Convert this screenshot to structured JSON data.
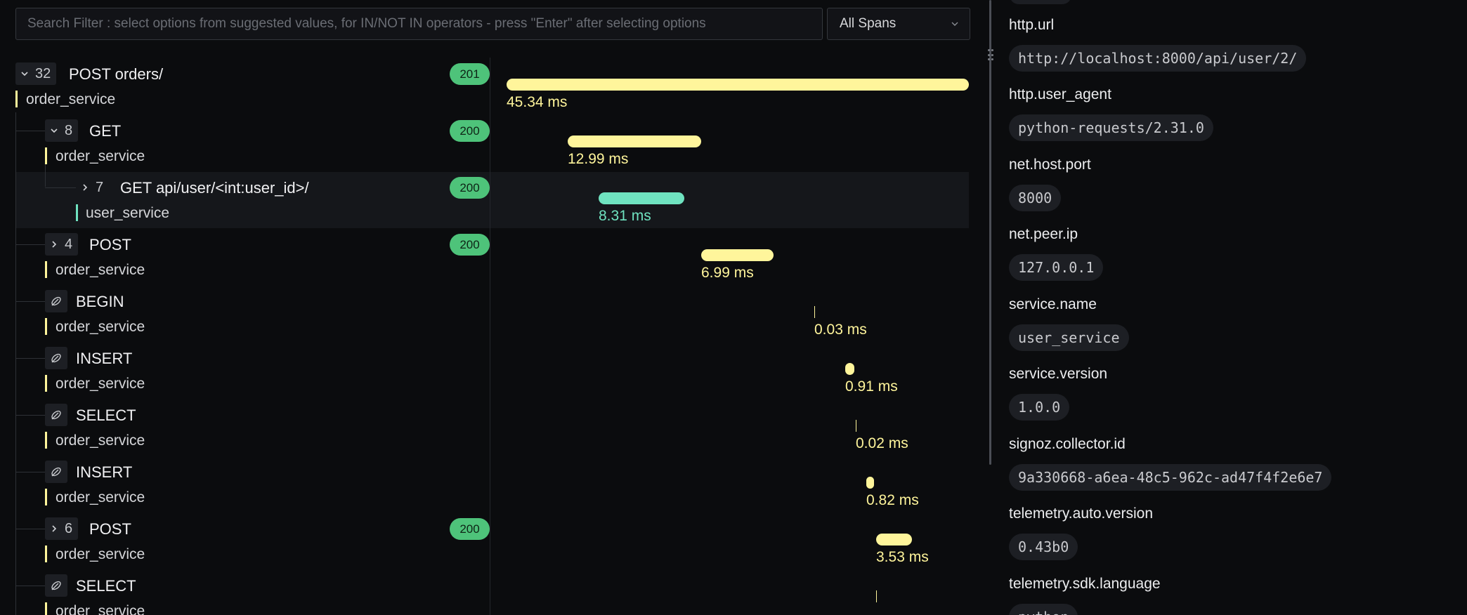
{
  "search": {
    "placeholder": "Search Filter : select options from suggested values, for IN/NOT IN operators - press \"Enter\" after selecting options"
  },
  "span_filter": {
    "selected": "All Spans"
  },
  "spans": [
    {
      "toggle": "32",
      "expanded": true,
      "name": "POST orders/",
      "service": "order_service",
      "status": "201",
      "duration": "45.34 ms",
      "color": "#fff59b"
    },
    {
      "toggle": "8",
      "expanded": true,
      "name": "GET",
      "service": "order_service",
      "status": "200",
      "duration": "12.99 ms",
      "color": "#fff59b"
    },
    {
      "toggle": "7",
      "expanded": false,
      "name": "GET api/user/<int:user_id>/",
      "service": "user_service",
      "status": "200",
      "duration": "8.31 ms",
      "color": "#6fe3c0"
    },
    {
      "toggle": "4",
      "expanded": false,
      "name": "POST",
      "service": "order_service",
      "status": "200",
      "duration": "6.99 ms",
      "color": "#fff59b"
    },
    {
      "icon": "database-icon",
      "name": "BEGIN",
      "service": "order_service",
      "duration": "0.03 ms",
      "color": "#fff59b"
    },
    {
      "icon": "database-icon",
      "name": "INSERT",
      "service": "order_service",
      "duration": "0.91 ms",
      "color": "#fff59b"
    },
    {
      "icon": "database-icon",
      "name": "SELECT",
      "service": "order_service",
      "duration": "0.02 ms",
      "color": "#fff59b"
    },
    {
      "icon": "database-icon",
      "name": "INSERT",
      "service": "order_service",
      "duration": "0.82 ms",
      "color": "#fff59b"
    },
    {
      "toggle": "6",
      "expanded": false,
      "name": "POST",
      "service": "order_service",
      "status": "200",
      "duration": "3.53 ms",
      "color": "#fff59b"
    },
    {
      "icon": "database-icon",
      "name": "SELECT",
      "service": "order_service",
      "duration": "",
      "color": "#fff59b"
    }
  ],
  "attributes": [
    {
      "key": "http.url",
      "value": "http://localhost:8000/api/user/2/"
    },
    {
      "key": "http.user_agent",
      "value": "python-requests/2.31.0"
    },
    {
      "key": "net.host.port",
      "value": "8000"
    },
    {
      "key": "net.peer.ip",
      "value": "127.0.0.1"
    },
    {
      "key": "service.name",
      "value": "user_service"
    },
    {
      "key": "service.version",
      "value": "1.0.0"
    },
    {
      "key": "signoz.collector.id",
      "value": "9a330668-a6ea-48c5-962c-ad47f4f2e6e7"
    },
    {
      "key": "telemetry.auto.version",
      "value": "0.43b0"
    },
    {
      "key": "telemetry.sdk.language",
      "value": "python"
    }
  ],
  "colors": {
    "order_service": "#fff59b",
    "user_service": "#6fe3c0",
    "status_ok": "#4ec37a"
  }
}
